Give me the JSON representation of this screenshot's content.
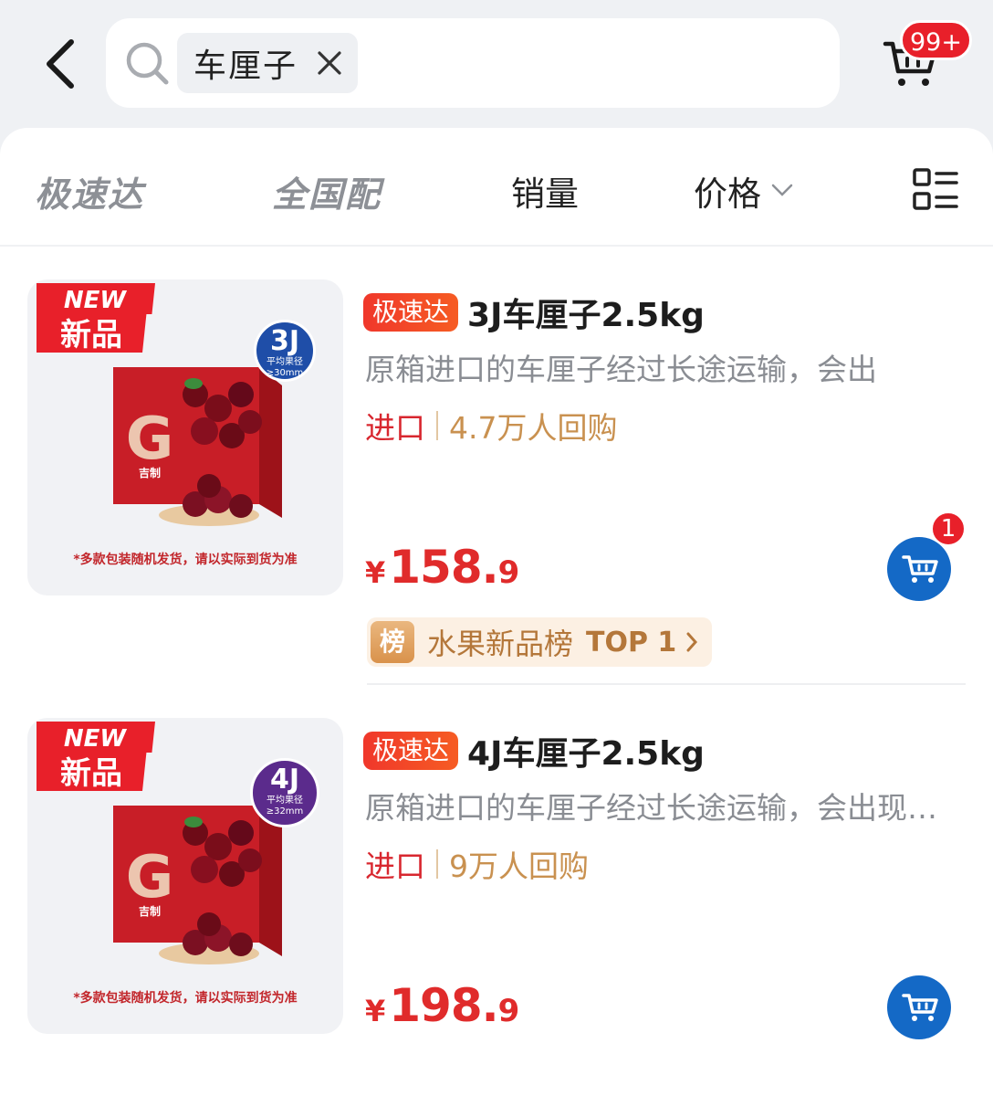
{
  "header": {
    "search_tag": "车厘子",
    "cart_badge": "99+"
  },
  "filters": {
    "tab_fast": "极速达",
    "tab_nationwide": "全国配",
    "sort_sales": "销量",
    "sort_price": "价格"
  },
  "products": [
    {
      "new_badge_top": "NEW",
      "new_badge_bottom": "新品",
      "spec_big": "3J",
      "spec_small_1": "平均果径",
      "spec_small_2": "≥30mm",
      "spec_color": "#1f4ea8",
      "brand_text": "吉制",
      "thumb_note": "*多款包装随机发货，请以实际到货为准",
      "tag": "极速达",
      "title": "3J车厘子2.5kg",
      "description": "原箱进口的车厘子经过长途运输，会出",
      "origin": "进口",
      "repurchase": "4.7万人回购",
      "price_symbol": "¥",
      "price_int": "158.",
      "price_dec": "9",
      "cart_count": "1",
      "rank_icon": "榜",
      "rank_label": "水果新品榜",
      "rank_top": "TOP 1"
    },
    {
      "new_badge_top": "NEW",
      "new_badge_bottom": "新品",
      "spec_big": "4J",
      "spec_small_1": "平均果径",
      "spec_small_2": "≥32mm",
      "spec_color": "#5b2b8c",
      "brand_text": "吉制",
      "thumb_note": "*多款包装随机发货，请以实际到货为准",
      "tag": "极速达",
      "title": "4J车厘子2.5kg",
      "description": "原箱进口的车厘子经过长途运输，会出现一些情况请谅解",
      "origin": "进口",
      "repurchase": "9万人回购",
      "price_symbol": "¥",
      "price_int": "198.",
      "price_dec": "9"
    }
  ],
  "colors": {
    "accent_red": "#e02b2b",
    "cart_blue": "#1469c6",
    "rank_gold": "#b4773a"
  }
}
